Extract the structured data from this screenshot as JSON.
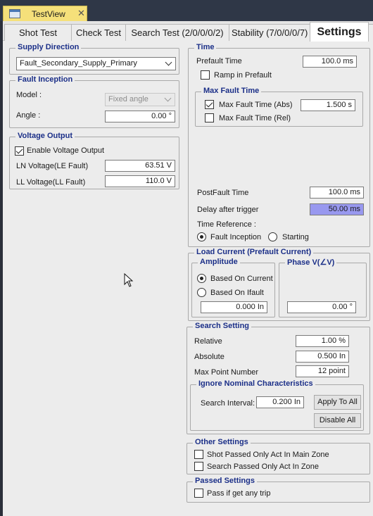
{
  "window": {
    "doc_tab_title": "TestView",
    "close_glyph": "✕"
  },
  "tabs": [
    {
      "label": "Shot Test"
    },
    {
      "label": "Check Test"
    },
    {
      "label": "Search Test (2/0/0/0/2)"
    },
    {
      "label": "Stability (7/0/0/0/7)"
    },
    {
      "label": "Settings"
    }
  ],
  "supply_direction": {
    "title": "Supply Direction",
    "selected": "Fault_Secondary_Supply_Primary"
  },
  "fault_inception": {
    "title": "Fault Inception",
    "model_label": "Model :",
    "model_value": "Fixed angle",
    "angle_label": "Angle :",
    "angle_value": "0.00 °"
  },
  "voltage_output": {
    "title": "Voltage Output",
    "enable_label": "Enable Voltage Output",
    "enable_checked": true,
    "ln_label": "LN Voltage(LE Fault)",
    "ln_value": "63.51 V",
    "ll_label": "LL Voltage(LL Fault)",
    "ll_value": "110.0 V"
  },
  "time": {
    "title": "Time",
    "prefault_label": "Prefault Time",
    "prefault_value": "100.0 ms",
    "ramp_label": "Ramp in Prefault",
    "max_fault_title": "Max Fault Time",
    "abs_label": "Max Fault Time (Abs)",
    "abs_value": "1.500 s",
    "rel_label": "Max Fault Time (Rel)",
    "postfault_label": "PostFault Time",
    "postfault_value": "100.0 ms",
    "delay_label": "Delay after trigger",
    "delay_value": "50.00 ms",
    "timeref_label": "Time Reference :",
    "ref_fault_label": "Fault Inception",
    "ref_start_label": "Starting"
  },
  "load_current": {
    "title": "Load Current (Prefault Current)",
    "amplitude_title": "Amplitude",
    "based_current_label": "Based On Current",
    "based_ifault_label": "Based On Ifault",
    "amplitude_value": "0.000 In",
    "phase_title": "Phase V(∠V)",
    "phase_value": "0.00 °"
  },
  "search_setting": {
    "title": "Search Setting",
    "relative_label": "Relative",
    "relative_value": "1.00 %",
    "absolute_label": "Absolute",
    "absolute_value": "0.500 In",
    "maxpoint_label": "Max Point Number",
    "maxpoint_value": "12 point",
    "ignore_title": "Ignore Nominal Characteristics",
    "interval_label": "Search Interval:",
    "interval_value": "0.200 In",
    "apply_all_label": "Apply To All",
    "disable_all_label": "Disable All"
  },
  "other_settings": {
    "title": "Other Settings",
    "shot_label": "Shot Passed Only Act In Main Zone",
    "search_label": "Search Passed Only Act In Zone"
  },
  "passed_settings": {
    "title": "Passed Settings",
    "pass_label": "Pass if get any trip"
  }
}
